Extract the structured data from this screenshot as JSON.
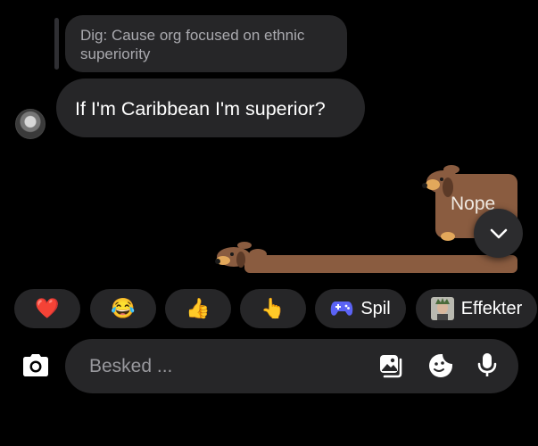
{
  "reply_quote": {
    "text": "Dig: Cause org focused on ethnic superiority"
  },
  "message": {
    "text": "If I'm Caribbean I'm superior?"
  },
  "sticker": {
    "text": "Nope"
  },
  "reactions": [
    {
      "emoji": "❤️"
    },
    {
      "emoji": "😂"
    },
    {
      "emoji": "👍"
    },
    {
      "emoji": "👆"
    }
  ],
  "actions": {
    "games_label": "Spil",
    "effects_label": "Effekter"
  },
  "composer": {
    "placeholder": "Besked ..."
  },
  "icons": {
    "camera": "camera-icon",
    "gallery": "gallery-icon",
    "sticker": "sticker-icon",
    "mic": "microphone-icon",
    "scroll": "chevron-down-icon",
    "games": "gamepad-icon"
  },
  "colors": {
    "background": "#000000",
    "bubble": "#262628",
    "games_icon": "#5b63f5",
    "sticker_brown": "#8a5c40"
  }
}
